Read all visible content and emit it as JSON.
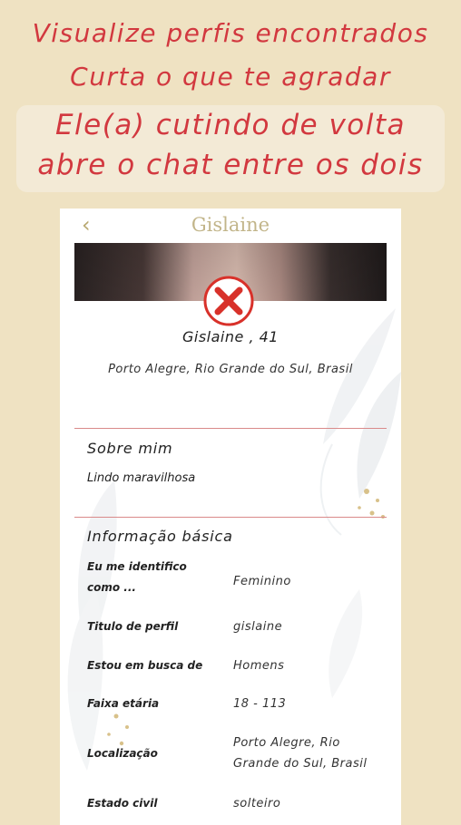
{
  "promo": {
    "line1": "Visualize perfis encontrados",
    "line2": "Curta o que te agradar",
    "line3": "Ele(a) cutindo de volta",
    "line4": "abre o chat entre os dois"
  },
  "header": {
    "back_icon": "‹",
    "title": "Gislaine"
  },
  "profile": {
    "name_age": "Gislaine , 41",
    "location": "Porto Alegre, Rio Grande do Sul, Brasil"
  },
  "about": {
    "title": "Sobre mim",
    "text": "Lindo maravilhosa"
  },
  "basic": {
    "title": "Informação básica",
    "rows": [
      {
        "label": "Eu me identifico como ...",
        "value": "Feminino"
      },
      {
        "label": "Titulo de perfil",
        "value": "gislaine"
      },
      {
        "label": "Estou em busca de",
        "value": "Homens"
      },
      {
        "label": "Faixa etária",
        "value": "18 - 113"
      },
      {
        "label": "Localização",
        "value": "Porto Alegre, Rio Grande do Sul, Brasil"
      },
      {
        "label": "Estado civil",
        "value": "solteiro"
      }
    ]
  },
  "colors": {
    "background": "#efe2c2",
    "promo_text": "#d2383f",
    "accent_gold": "#c2b58a",
    "close_red": "#d8312a"
  },
  "icons": {
    "back": "chevron-left-icon",
    "reject": "close-icon"
  }
}
